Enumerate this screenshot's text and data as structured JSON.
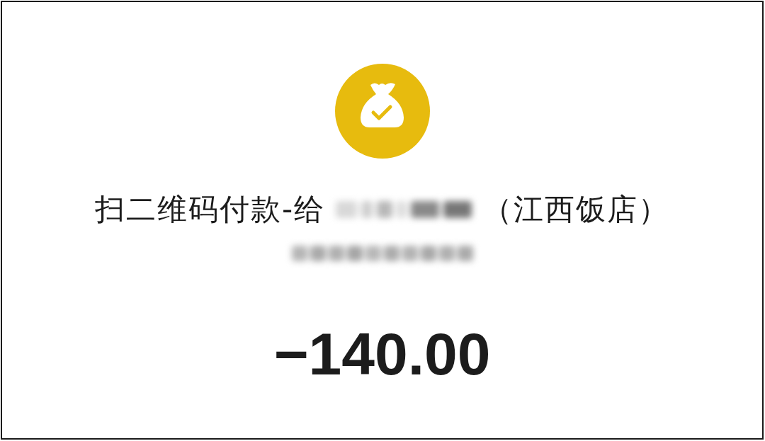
{
  "icon": {
    "kind": "money_bag_check"
  },
  "title": {
    "prefix": "扫二维码付款-给",
    "payee_redacted": true,
    "suffix": "（江西饭店）"
  },
  "account": {
    "redacted": true
  },
  "amount": "−140.00"
}
